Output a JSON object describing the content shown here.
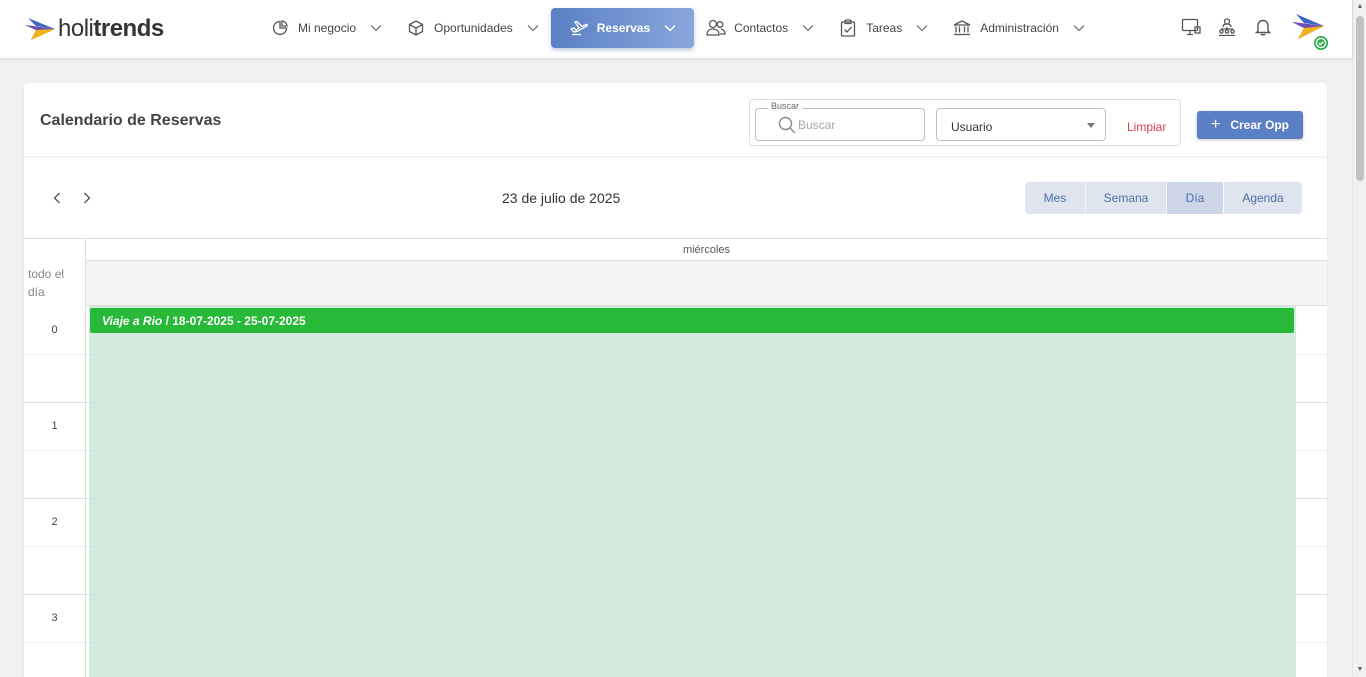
{
  "brand": {
    "name_light": "holi",
    "name_bold": "trends"
  },
  "nav": {
    "items": [
      {
        "label": "Mi negocio",
        "icon": "pie-chart-icon"
      },
      {
        "label": "Oportunidades",
        "icon": "box-icon"
      },
      {
        "label": "Reservas",
        "icon": "plane-icon",
        "active": true
      },
      {
        "label": "Contactos",
        "icon": "users-icon"
      },
      {
        "label": "Tareas",
        "icon": "clipboard-check-icon"
      },
      {
        "label": "Administración",
        "icon": "bank-icon"
      }
    ]
  },
  "top_icons": [
    "monitor-icon",
    "org-chart-icon",
    "bell-icon"
  ],
  "page": {
    "title": "Calendario de Reservas"
  },
  "filters": {
    "search_legend": "Buscar",
    "search_placeholder": "Buscar",
    "search_value": "",
    "user_select_value": "Usuario",
    "clear_label": "Limpiar"
  },
  "create_button": {
    "label": "Crear Opp"
  },
  "calendar": {
    "current_date": "23 de julio de 2025",
    "views": [
      "Mes",
      "Semana",
      "Día",
      "Agenda"
    ],
    "active_view": "Día",
    "day_name": "miércoles",
    "allday_label": "todo el día",
    "hours": [
      "0",
      "1",
      "2",
      "3"
    ],
    "event": {
      "title": "Viaje a Rio",
      "dates": " / 18-07-2025 - 25-07-2025"
    }
  },
  "colors": {
    "primary": "#5a7fc4",
    "event": "#27b937",
    "event_bg": "#d3ebdd",
    "danger": "#d9414e"
  }
}
